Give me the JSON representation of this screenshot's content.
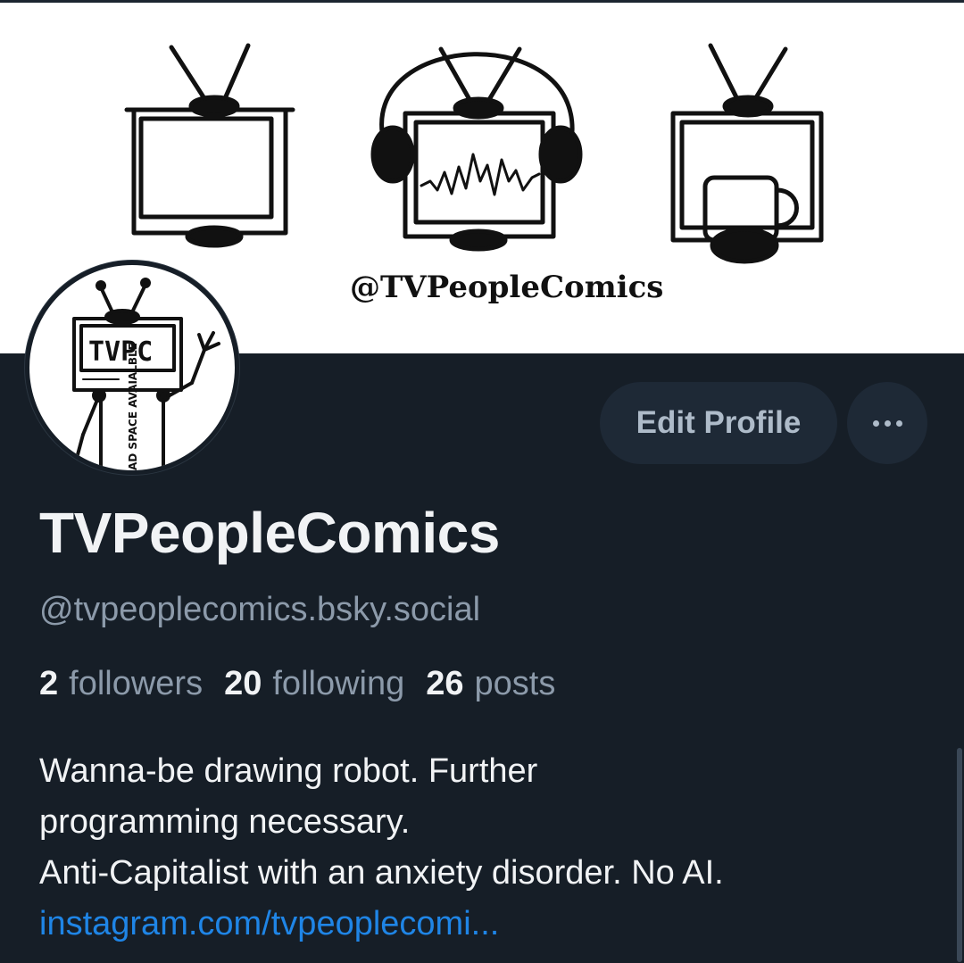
{
  "banner": {
    "signature": "@TVPeopleComics"
  },
  "avatar": {
    "screen_text": "TVPC",
    "sign_text": "AD SPACE AVAIALBLE"
  },
  "actions": {
    "edit_label": "Edit Profile",
    "more_icon": "ellipsis-icon"
  },
  "profile": {
    "display_name": "TVPeopleComics",
    "handle": "@tvpeoplecomics.bsky.social",
    "stats": [
      {
        "value": "2",
        "label": "followers"
      },
      {
        "value": "20",
        "label": "following"
      },
      {
        "value": "26",
        "label": "posts"
      }
    ],
    "bio_lines": [
      "Wanna-be drawing robot. Further",
      "programming necessary.",
      "Anti-Capitalist with an anxiety disorder. No AI."
    ],
    "link_text": "instagram.com/tvpeoplecomi..."
  },
  "colors": {
    "background": "#161e27",
    "button": "#1e2936",
    "link": "#1f85e6",
    "muted": "#8c9aaa"
  }
}
